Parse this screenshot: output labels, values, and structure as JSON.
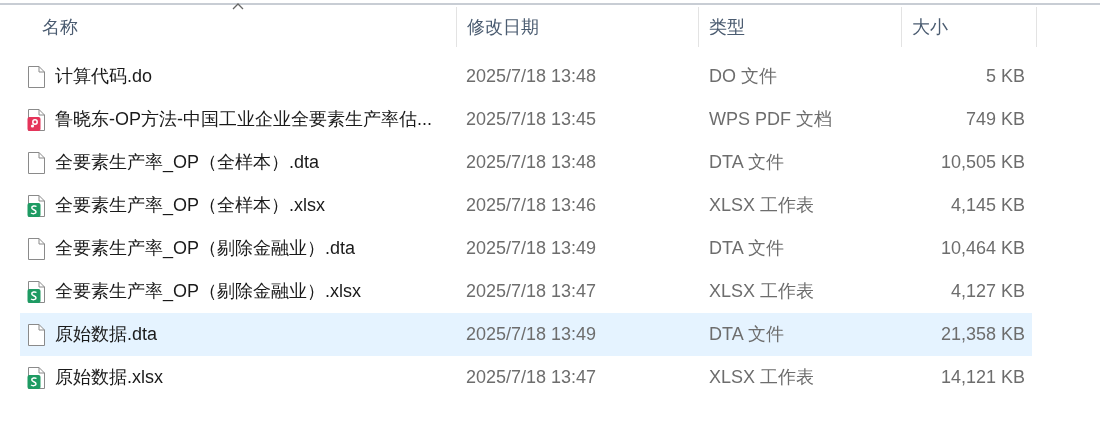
{
  "columns": [
    {
      "label": "名称",
      "sorted": true
    },
    {
      "label": "修改日期",
      "sorted": false
    },
    {
      "label": "类型",
      "sorted": false
    },
    {
      "label": "大小",
      "sorted": false
    }
  ],
  "files": [
    {
      "name": "计算代码.do",
      "modified": "2025/7/18 13:48",
      "type": "DO 文件",
      "size": "5 KB",
      "kind": "blank",
      "selected": false
    },
    {
      "name": "鲁晓东-OP方法-中国工业企业全要素生产率估...",
      "modified": "2025/7/18 13:45",
      "type": "WPS PDF 文档",
      "size": "749 KB",
      "kind": "pdf",
      "selected": false
    },
    {
      "name": "全要素生产率_OP（全样本）.dta",
      "modified": "2025/7/18 13:48",
      "type": "DTA 文件",
      "size": "10,505 KB",
      "kind": "blank",
      "selected": false
    },
    {
      "name": "全要素生产率_OP（全样本）.xlsx",
      "modified": "2025/7/18 13:46",
      "type": "XLSX 工作表",
      "size": "4,145 KB",
      "kind": "sheet",
      "selected": false
    },
    {
      "name": "全要素生产率_OP（剔除金融业）.dta",
      "modified": "2025/7/18 13:49",
      "type": "DTA 文件",
      "size": "10,464 KB",
      "kind": "blank",
      "selected": false
    },
    {
      "name": "全要素生产率_OP（剔除金融业）.xlsx",
      "modified": "2025/7/18 13:47",
      "type": "XLSX 工作表",
      "size": "4,127 KB",
      "kind": "sheet",
      "selected": false
    },
    {
      "name": "原始数据.dta",
      "modified": "2025/7/18 13:49",
      "type": "DTA 文件",
      "size": "21,358 KB",
      "kind": "blank",
      "selected": true
    },
    {
      "name": "原始数据.xlsx",
      "modified": "2025/7/18 13:47",
      "type": "XLSX 工作表",
      "size": "14,121 KB",
      "kind": "sheet",
      "selected": false
    }
  ]
}
